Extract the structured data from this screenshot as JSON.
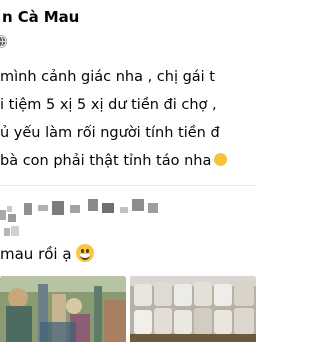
{
  "post": {
    "group_name": "n Cà Mau",
    "lines": [
      "mình cảnh giác nha , chị gái t",
      "i tiệm 5 xị 5 xị dư tiền đi chợ ,",
      "ủ yếu làm rối người tính tiền đ",
      "bà con phải thật tỉnh táo nha"
    ]
  },
  "comment": {
    "text": "mau rồi ạ"
  },
  "icons": {
    "privacy": "globe-icon",
    "emoji_line": "smiling-face-emoji",
    "emoji_comment": "grinning-face-emoji"
  },
  "colors": {
    "text": "#050505",
    "muted": "#65676b",
    "divider": "#e4e6eb"
  }
}
